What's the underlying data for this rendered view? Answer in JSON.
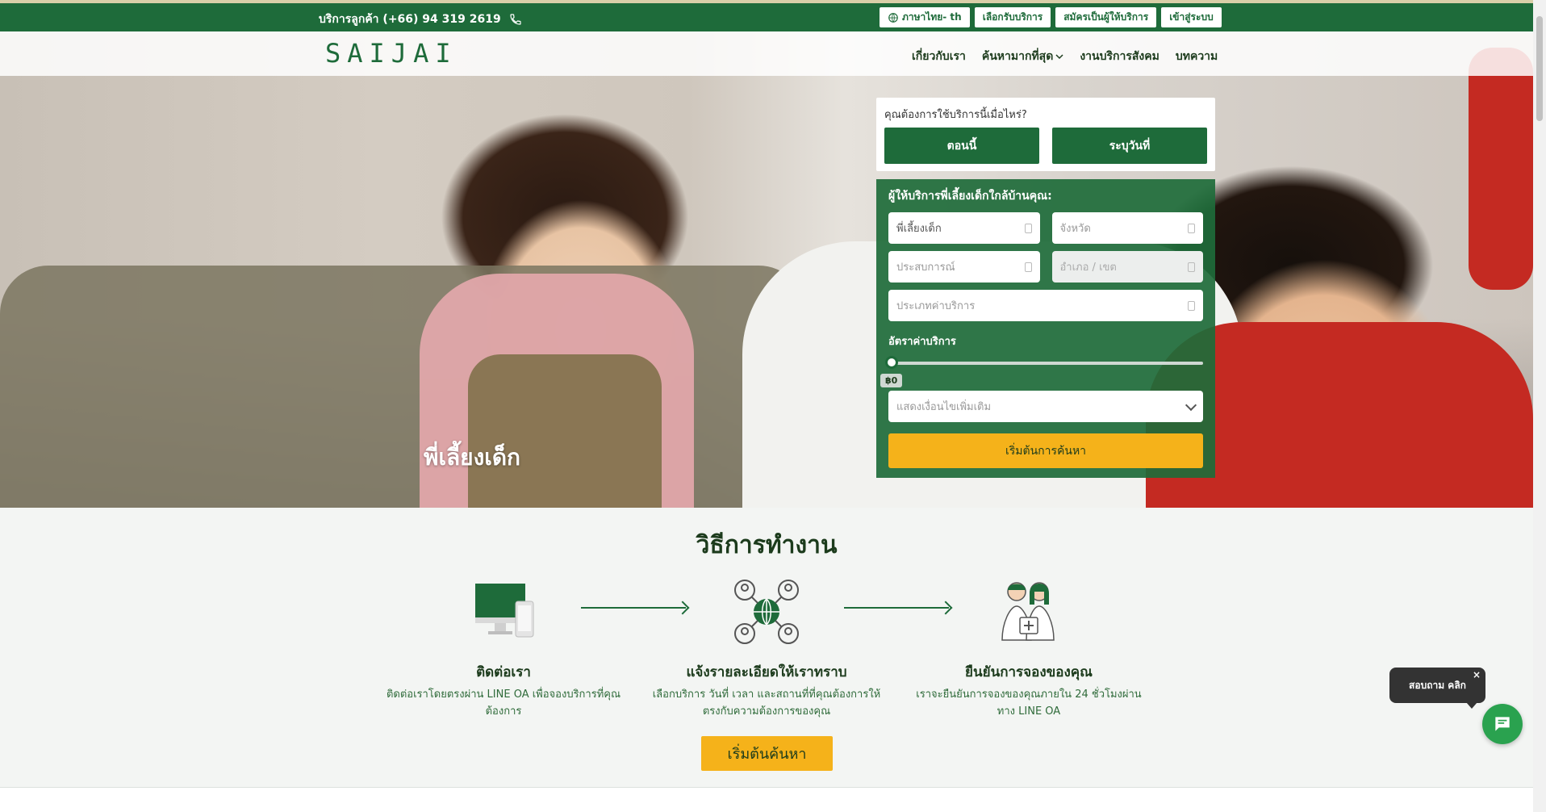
{
  "topbar": {
    "phone": "บริการลูกค้า (+66) 94 319 2619",
    "language": "ภาษาไทย- th",
    "buttons": [
      "เลือกรับบริการ",
      "สมัครเป็นผู้ให้บริการ",
      "เข้าสู่ระบบ"
    ]
  },
  "navbar": {
    "logo": "SAIJAI",
    "items": [
      "เกี่ยวกับเรา",
      "ค้นหามากที่สุด",
      "งานบริการสังคม",
      "บทความ"
    ]
  },
  "hero": {
    "caption": "พี่เลี้ยงเด็ก"
  },
  "when": {
    "question": "คุณต้องการใช้บริการนี้เมื่อไหร่?",
    "now": "ตอนนี้",
    "pick_date": "ระบุวันที่"
  },
  "search": {
    "title": "ผู้ให้บริการพี่เลี้ยงเด็กใกล้บ้านคุณ:",
    "service_type": "พี่เลี้ยงเด็ก",
    "province_placeholder": "จังหวัด",
    "experience_placeholder": "ประสบการณ์",
    "district_placeholder": "อำเภอ / เขต",
    "rate_type_placeholder": "ประเภทค่าบริการ",
    "rate_label": "อัตราค่าบริการ",
    "price_value": "฿0",
    "price_fraction": 0,
    "more_options": "แสดงเงื่อนไขเพิ่มเติม",
    "search_button": "เริ่มต้นการค้นหา"
  },
  "how": {
    "title": "วิธีการทำงาน",
    "steps": [
      {
        "title": "ติดต่อเรา",
        "desc": "ติดต่อเราโดยตรงผ่าน LINE OA เพื่อจองบริการที่คุณต้องการ"
      },
      {
        "title": "แจ้งรายละเอียดให้เราทราบ",
        "desc": "เลือกบริการ วันที่ เวลา และสถานที่ที่คุณต้องการให้ตรงกับความต้องการของคุณ"
      },
      {
        "title": "ยืนยันการจองของคุณ",
        "desc": "เราจะยืนยันการจองของคุณภายใน 24 ชั่วโมงผ่านทาง LINE OA"
      }
    ],
    "cta": "เริ่มต้นค้นหา"
  },
  "chat": {
    "bubble": "สอบถาม คลิก",
    "close": "×"
  },
  "colors": {
    "brand_green": "#1e6b3a",
    "accent_yellow": "#f5b21a"
  }
}
